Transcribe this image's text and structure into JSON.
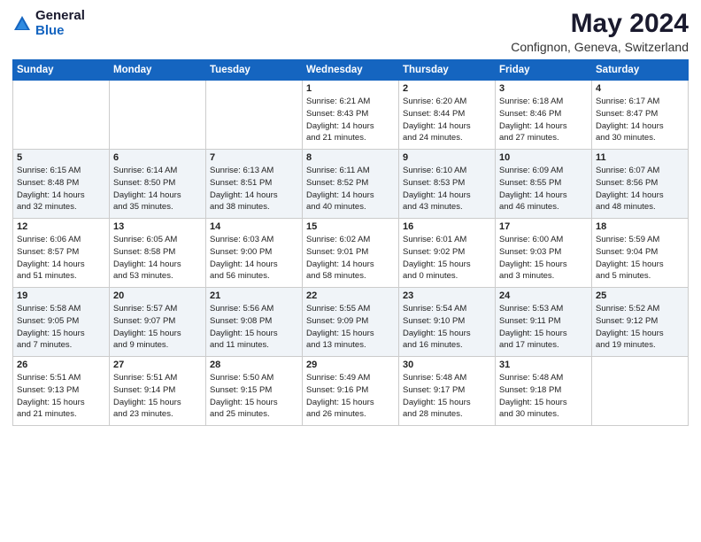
{
  "header": {
    "logo_general": "General",
    "logo_blue": "Blue",
    "title": "May 2024",
    "subtitle": "Confignon, Geneva, Switzerland"
  },
  "calendar": {
    "days_of_week": [
      "Sunday",
      "Monday",
      "Tuesday",
      "Wednesday",
      "Thursday",
      "Friday",
      "Saturday"
    ],
    "weeks": [
      [
        {
          "day": "",
          "info": ""
        },
        {
          "day": "",
          "info": ""
        },
        {
          "day": "",
          "info": ""
        },
        {
          "day": "1",
          "info": "Sunrise: 6:21 AM\nSunset: 8:43 PM\nDaylight: 14 hours\nand 21 minutes."
        },
        {
          "day": "2",
          "info": "Sunrise: 6:20 AM\nSunset: 8:44 PM\nDaylight: 14 hours\nand 24 minutes."
        },
        {
          "day": "3",
          "info": "Sunrise: 6:18 AM\nSunset: 8:46 PM\nDaylight: 14 hours\nand 27 minutes."
        },
        {
          "day": "4",
          "info": "Sunrise: 6:17 AM\nSunset: 8:47 PM\nDaylight: 14 hours\nand 30 minutes."
        }
      ],
      [
        {
          "day": "5",
          "info": "Sunrise: 6:15 AM\nSunset: 8:48 PM\nDaylight: 14 hours\nand 32 minutes."
        },
        {
          "day": "6",
          "info": "Sunrise: 6:14 AM\nSunset: 8:50 PM\nDaylight: 14 hours\nand 35 minutes."
        },
        {
          "day": "7",
          "info": "Sunrise: 6:13 AM\nSunset: 8:51 PM\nDaylight: 14 hours\nand 38 minutes."
        },
        {
          "day": "8",
          "info": "Sunrise: 6:11 AM\nSunset: 8:52 PM\nDaylight: 14 hours\nand 40 minutes."
        },
        {
          "day": "9",
          "info": "Sunrise: 6:10 AM\nSunset: 8:53 PM\nDaylight: 14 hours\nand 43 minutes."
        },
        {
          "day": "10",
          "info": "Sunrise: 6:09 AM\nSunset: 8:55 PM\nDaylight: 14 hours\nand 46 minutes."
        },
        {
          "day": "11",
          "info": "Sunrise: 6:07 AM\nSunset: 8:56 PM\nDaylight: 14 hours\nand 48 minutes."
        }
      ],
      [
        {
          "day": "12",
          "info": "Sunrise: 6:06 AM\nSunset: 8:57 PM\nDaylight: 14 hours\nand 51 minutes."
        },
        {
          "day": "13",
          "info": "Sunrise: 6:05 AM\nSunset: 8:58 PM\nDaylight: 14 hours\nand 53 minutes."
        },
        {
          "day": "14",
          "info": "Sunrise: 6:03 AM\nSunset: 9:00 PM\nDaylight: 14 hours\nand 56 minutes."
        },
        {
          "day": "15",
          "info": "Sunrise: 6:02 AM\nSunset: 9:01 PM\nDaylight: 14 hours\nand 58 minutes."
        },
        {
          "day": "16",
          "info": "Sunrise: 6:01 AM\nSunset: 9:02 PM\nDaylight: 15 hours\nand 0 minutes."
        },
        {
          "day": "17",
          "info": "Sunrise: 6:00 AM\nSunset: 9:03 PM\nDaylight: 15 hours\nand 3 minutes."
        },
        {
          "day": "18",
          "info": "Sunrise: 5:59 AM\nSunset: 9:04 PM\nDaylight: 15 hours\nand 5 minutes."
        }
      ],
      [
        {
          "day": "19",
          "info": "Sunrise: 5:58 AM\nSunset: 9:05 PM\nDaylight: 15 hours\nand 7 minutes."
        },
        {
          "day": "20",
          "info": "Sunrise: 5:57 AM\nSunset: 9:07 PM\nDaylight: 15 hours\nand 9 minutes."
        },
        {
          "day": "21",
          "info": "Sunrise: 5:56 AM\nSunset: 9:08 PM\nDaylight: 15 hours\nand 11 minutes."
        },
        {
          "day": "22",
          "info": "Sunrise: 5:55 AM\nSunset: 9:09 PM\nDaylight: 15 hours\nand 13 minutes."
        },
        {
          "day": "23",
          "info": "Sunrise: 5:54 AM\nSunset: 9:10 PM\nDaylight: 15 hours\nand 16 minutes."
        },
        {
          "day": "24",
          "info": "Sunrise: 5:53 AM\nSunset: 9:11 PM\nDaylight: 15 hours\nand 17 minutes."
        },
        {
          "day": "25",
          "info": "Sunrise: 5:52 AM\nSunset: 9:12 PM\nDaylight: 15 hours\nand 19 minutes."
        }
      ],
      [
        {
          "day": "26",
          "info": "Sunrise: 5:51 AM\nSunset: 9:13 PM\nDaylight: 15 hours\nand 21 minutes."
        },
        {
          "day": "27",
          "info": "Sunrise: 5:51 AM\nSunset: 9:14 PM\nDaylight: 15 hours\nand 23 minutes."
        },
        {
          "day": "28",
          "info": "Sunrise: 5:50 AM\nSunset: 9:15 PM\nDaylight: 15 hours\nand 25 minutes."
        },
        {
          "day": "29",
          "info": "Sunrise: 5:49 AM\nSunset: 9:16 PM\nDaylight: 15 hours\nand 26 minutes."
        },
        {
          "day": "30",
          "info": "Sunrise: 5:48 AM\nSunset: 9:17 PM\nDaylight: 15 hours\nand 28 minutes."
        },
        {
          "day": "31",
          "info": "Sunrise: 5:48 AM\nSunset: 9:18 PM\nDaylight: 15 hours\nand 30 minutes."
        },
        {
          "day": "",
          "info": ""
        }
      ]
    ]
  }
}
